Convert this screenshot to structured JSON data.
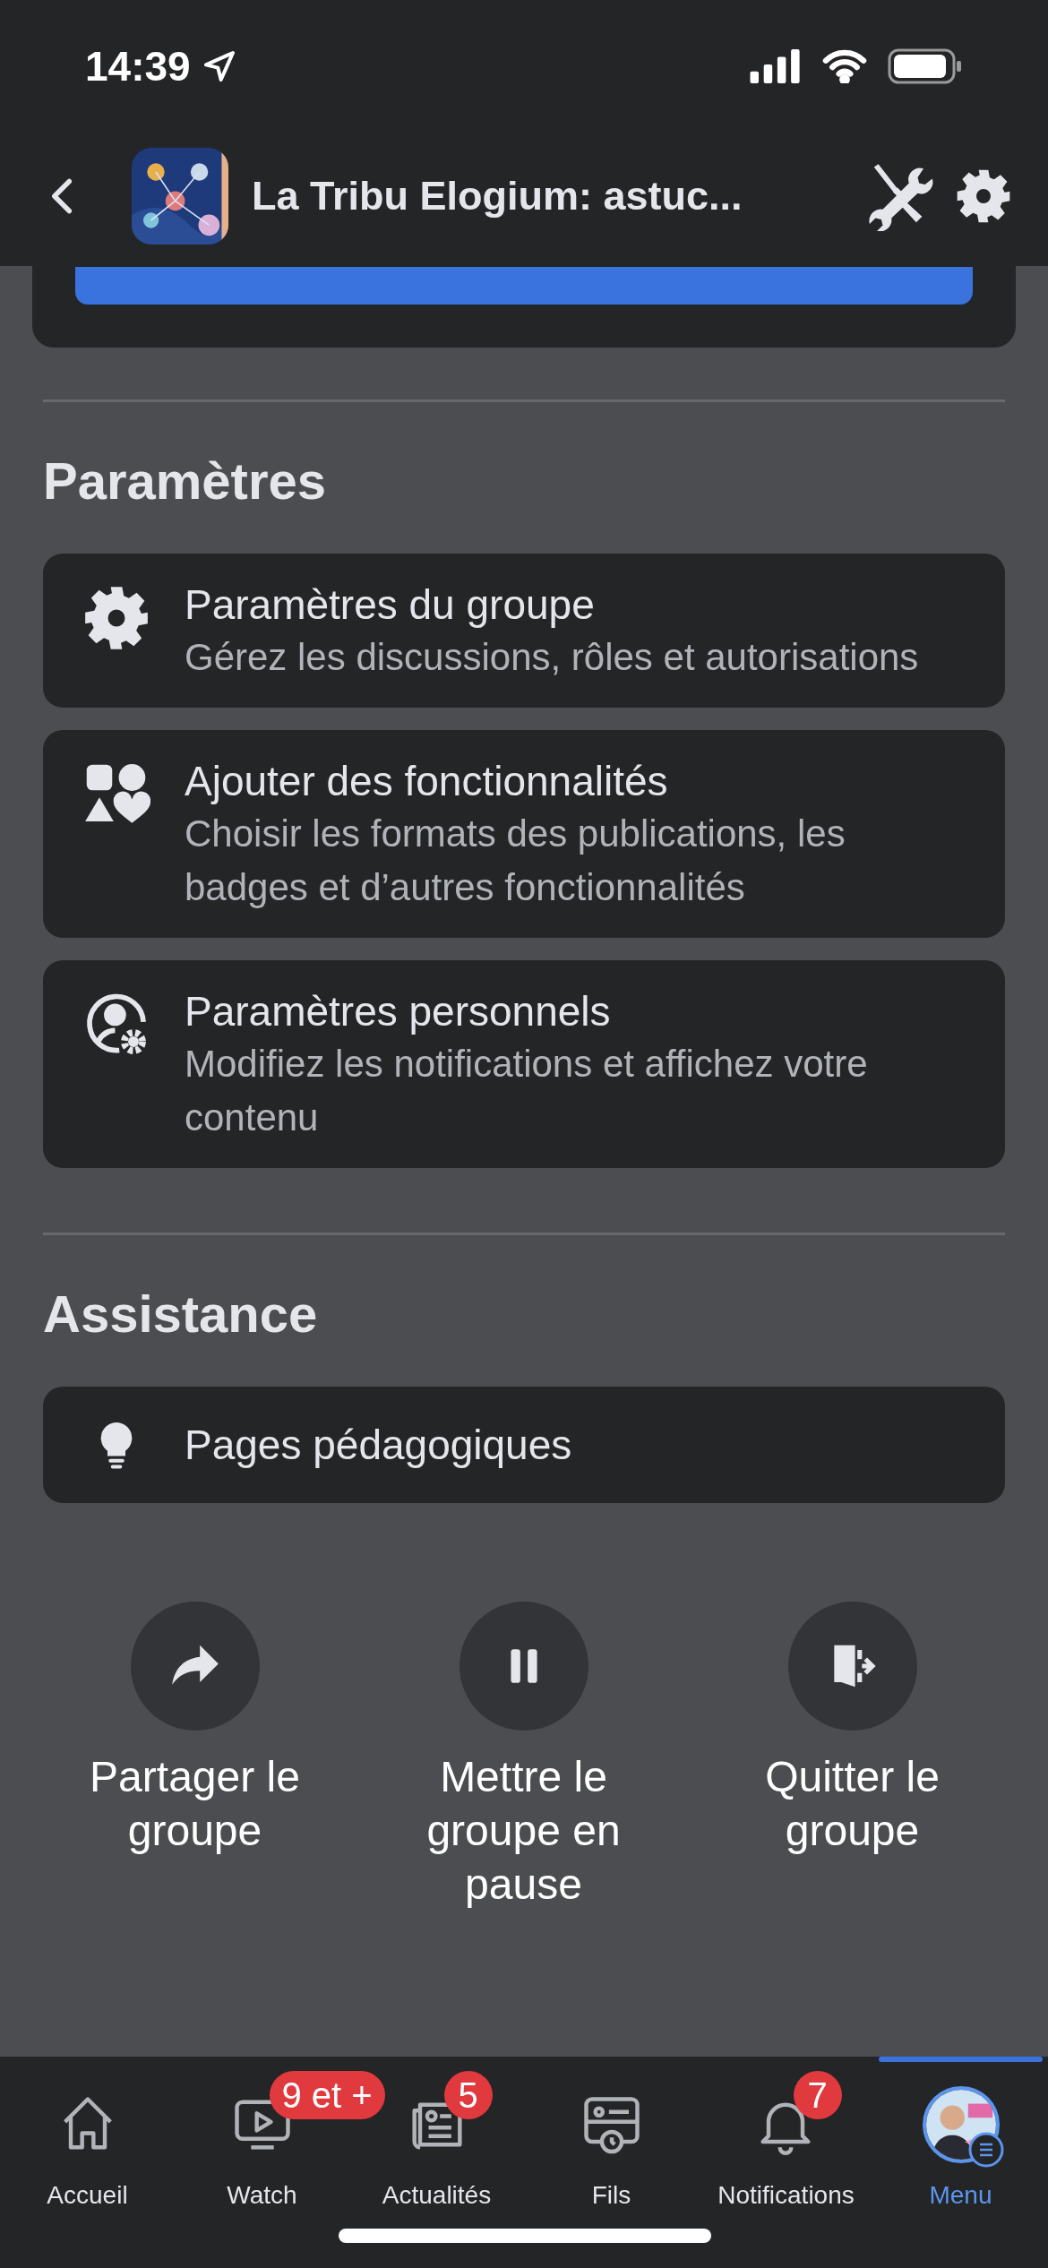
{
  "status_bar": {
    "time": "14:39"
  },
  "header": {
    "title": "La Tribu Elogium: astuc..."
  },
  "sections": [
    {
      "title": "Paramètres",
      "items": [
        {
          "kind": "gear",
          "title": "Paramètres du groupe",
          "subtitle": "Gérez les discussions, rôles et autorisations"
        },
        {
          "kind": "shapes",
          "title": "Ajouter des fonctionnalités",
          "subtitle": "Choisir les formats des publications, les badges et d’autres fonctionnalités"
        },
        {
          "kind": "person-gear",
          "title": "Paramètres personnels",
          "subtitle": "Modifiez les notifications et affichez votre contenu"
        }
      ]
    },
    {
      "title": "Assistance",
      "items": [
        {
          "kind": "bulb",
          "title": "Pages pédagogiques"
        }
      ]
    }
  ],
  "actions": [
    {
      "kind": "share",
      "label": "Partager le groupe"
    },
    {
      "kind": "pause",
      "label": "Mettre le groupe en pause"
    },
    {
      "kind": "leave",
      "label": "Quitter le groupe"
    }
  ],
  "tab_bar": [
    {
      "kind": "home",
      "label": "Accueil",
      "selected": false
    },
    {
      "kind": "watch",
      "label": "Watch",
      "badge": "9 et +",
      "selected": false
    },
    {
      "kind": "news",
      "label": "Actualités",
      "badge": "5",
      "selected": false
    },
    {
      "kind": "feeds",
      "label": "Fils",
      "selected": false
    },
    {
      "kind": "bell",
      "label": "Notifications",
      "badge": "7",
      "selected": false
    },
    {
      "kind": "avatar",
      "label": "Menu",
      "selected": true
    }
  ]
}
